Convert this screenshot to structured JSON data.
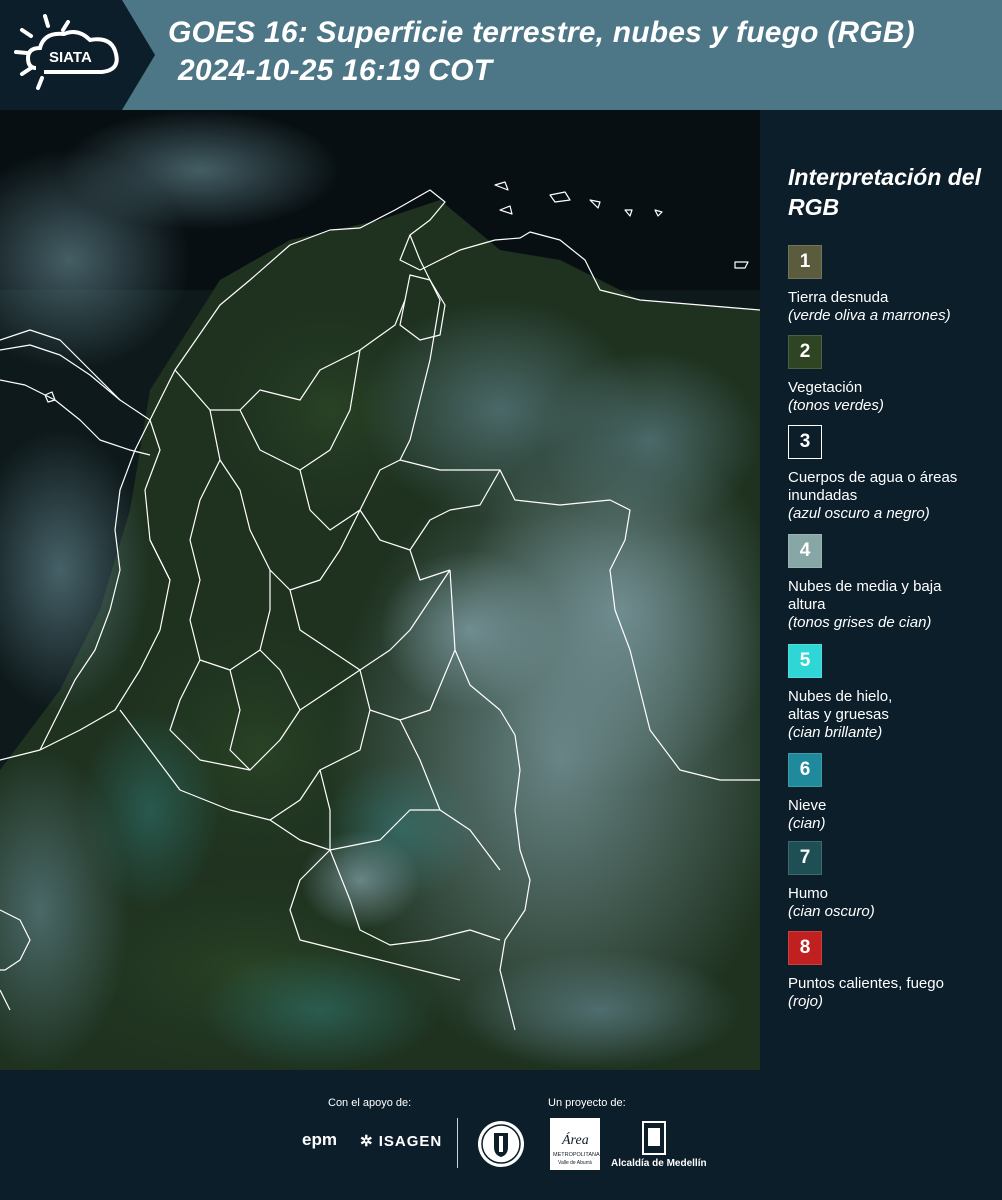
{
  "header": {
    "logo_text": "SIATA",
    "title_line1": "GOES 16: Superficie terrestre, nubes y fuego (RGB)",
    "title_line2": "2024-10-25 16:19 COT"
  },
  "legend": {
    "title": "Interpretación del RGB",
    "items": [
      {
        "number": "1",
        "label": "Tierra desnuda",
        "sub": "(verde oliva a marrones)",
        "color": "#5b5b3d"
      },
      {
        "number": "2",
        "label": "Vegetación",
        "sub": "(tonos verdes)",
        "color": "#2e4423"
      },
      {
        "number": "3",
        "label": "Cuerpos de agua o áreas inundadas",
        "sub": "(azul oscuro a negro)",
        "color": "#0c1e2a"
      },
      {
        "number": "4",
        "label": "Nubes de media y baja altura",
        "sub": "(tonos grises de cian)",
        "color": "#86a7a6"
      },
      {
        "number": "5",
        "label": "Nubes de hielo, altas y gruesas",
        "sub": "(cian brillante)",
        "color": "#2fd6d6"
      },
      {
        "number": "6",
        "label": "Nieve",
        "sub": "(cian)",
        "color": "#1f8a9b"
      },
      {
        "number": "7",
        "label": "Humo",
        "sub": "(cian oscuro)",
        "color": "#1e4f55"
      },
      {
        "number": "8",
        "label": "Puntos calientes, fuego",
        "sub": "(rojo)",
        "color": "#c0201f"
      }
    ]
  },
  "footer": {
    "support_label": "Con el apoyo de:",
    "project_label": "Un proyecto de:",
    "epm": "epm",
    "isagen": "ISAGEN",
    "area_text_1": "Área",
    "area_text_2": "METROPOLITANA",
    "area_text_3": "Valle de Aburrá",
    "medellin": "Alcaldía de Medellín"
  },
  "colors": {
    "header_bg": "#4d7686",
    "logo_bg": "#0c1e2a",
    "page_bg": "#0c1e2a",
    "border_lines": "#ffffff"
  }
}
